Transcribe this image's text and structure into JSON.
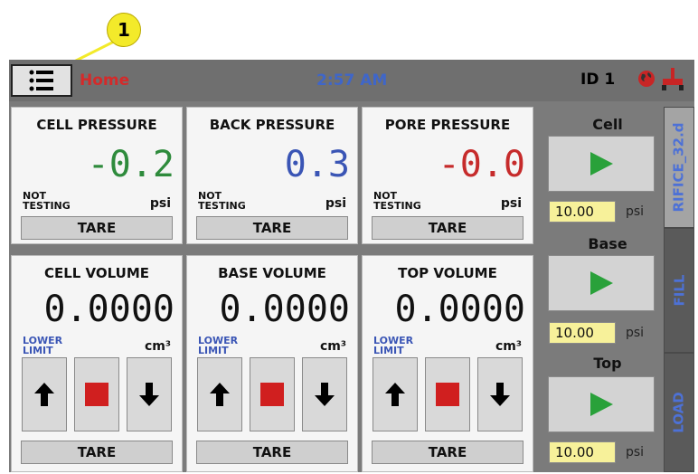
{
  "callout": {
    "number": "1"
  },
  "topbar": {
    "screen_title": "Home",
    "time": "2:57 AM",
    "device_id": "ID 1"
  },
  "pressures": [
    {
      "title": "CELL PRESSURE",
      "value": "-0.2",
      "color": "#2e8b3c",
      "status_line1": "NOT",
      "status_line2": "TESTING",
      "unit": "psi",
      "tare_label": "TARE"
    },
    {
      "title": "BACK PRESSURE",
      "value": "0.3",
      "color": "#3a55b5",
      "status_line1": "NOT",
      "status_line2": "TESTING",
      "unit": "psi",
      "tare_label": "TARE"
    },
    {
      "title": "PORE PRESSURE",
      "value": "-0.0",
      "color": "#c62b2b",
      "status_line1": "NOT",
      "status_line2": "TESTING",
      "unit": "psi",
      "tare_label": "TARE"
    }
  ],
  "volumes": [
    {
      "title": "CELL VOLUME",
      "value": "0.0000",
      "limit_line1": "LOWER",
      "limit_line2": "LIMIT",
      "unit": "cm³",
      "tare_label": "TARE"
    },
    {
      "title": "BASE VOLUME",
      "value": "0.0000",
      "limit_line1": "LOWER",
      "limit_line2": "LIMIT",
      "unit": "cm³",
      "tare_label": "TARE"
    },
    {
      "title": "TOP VOLUME",
      "value": "0.0000",
      "limit_line1": "LOWER",
      "limit_line2": "LIMIT",
      "unit": "cm³",
      "tare_label": "TARE"
    }
  ],
  "side_panel": {
    "pumps": [
      {
        "label": "Cell",
        "setpoint": "10.00",
        "unit": "psi"
      },
      {
        "label": "Base",
        "setpoint": "10.00",
        "unit": "psi"
      },
      {
        "label": "Top",
        "setpoint": "10.00",
        "unit": "psi"
      }
    ],
    "tabs": [
      "RIFICE_32.d",
      "FILL",
      "LOAD"
    ]
  },
  "icons": {
    "menu": "menu-list-icon",
    "globe": "globe-icon",
    "plug": "plug-icon",
    "play": "play-icon",
    "up": "arrow-up-icon",
    "stop": "stop-icon",
    "down": "arrow-down-icon"
  },
  "colors": {
    "accent_red": "#d42a2a",
    "accent_blue": "#3f66c9",
    "play_green": "#29a13a",
    "stop_red": "#d01f1f",
    "setpoint_bg": "#f7f19a"
  }
}
